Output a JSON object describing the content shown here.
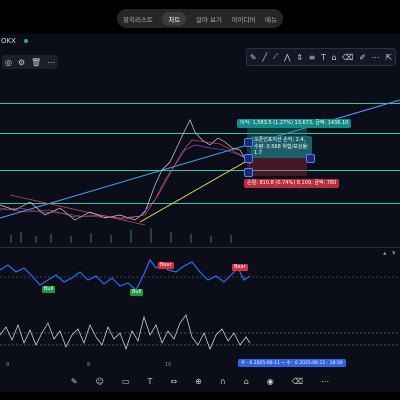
{
  "nav": {
    "tabs": [
      {
        "label": "왓치리스트",
        "active": false
      },
      {
        "label": "차트",
        "active": true
      },
      {
        "label": "알아 보기",
        "active": false
      },
      {
        "label": "아이디어",
        "active": false
      },
      {
        "label": "메뉴",
        "active": false
      }
    ]
  },
  "symbol": {
    "label": "OKX"
  },
  "toolbar": {
    "icons": [
      "eye-icon",
      "settings-icon",
      "trash-icon",
      "more-icon"
    ]
  },
  "drawing_toolbar": {
    "icons": [
      "pen-icon",
      "line-icon",
      "ray-icon",
      "pattern-icon",
      "measure-icon",
      "fib-icon",
      "text-icon",
      "lock-icon",
      "trash-icon",
      "brush-icon",
      "more-icon",
      "cursor-icon"
    ]
  },
  "position_tool": {
    "take_profit_label": "이익: 1,583.5 (1.27%) 13,673, 금액: 1436.10",
    "info_label": "오픈인포지션 손익: 2.4, 수량: 0.568 위험/보상율: 1.7",
    "stop_loss_label": "손절: 810.8 (0.74%) 8,109, 금액: 780"
  },
  "oscillator": {
    "signals": [
      {
        "label": "Bear",
        "type": "bear"
      },
      {
        "label": "Bear",
        "type": "bear"
      },
      {
        "label": "Bull",
        "type": "bull"
      },
      {
        "label": "Bull",
        "type": "bull"
      }
    ]
  },
  "x_axis": {
    "labels": [
      "9",
      "8",
      "10"
    ]
  },
  "date_range": "수 · 6 2025-06-11 ~ 수 · 6 2025-06-11 · 18:30",
  "bottom_toolbar": {
    "icons": [
      "pen-icon",
      "emoji-icon",
      "shape-icon",
      "text-icon",
      "ruler-icon",
      "zoom-icon",
      "magnet-icon",
      "lock-icon",
      "visibility-icon",
      "trash-icon",
      "more-icon"
    ]
  },
  "colors": {
    "background": "#0b0e18",
    "level_line": "#2ec9a4",
    "oscillator_line": "#2e6cf0",
    "volatility_line": "#e6e6e6",
    "trend_yellow": "#e8e35a",
    "trend_blue": "#4aa3ff",
    "bear_signal": "#d6303f",
    "bull_signal": "#1a9b3f"
  }
}
